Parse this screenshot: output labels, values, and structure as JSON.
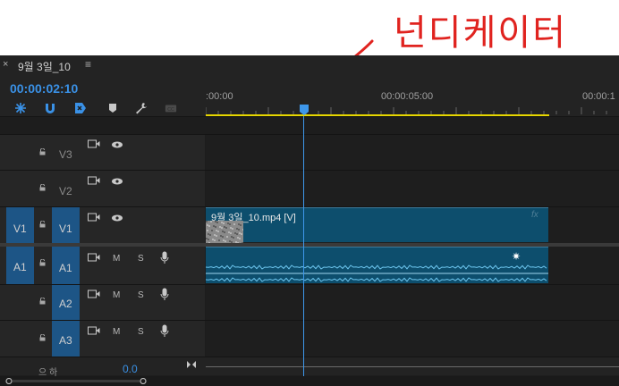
{
  "annotation": {
    "text": "넌디케이터"
  },
  "tab": {
    "close": "×",
    "title": "9월 3일_10",
    "menu": "≡"
  },
  "header": {
    "timecode": "00:00:02:10"
  },
  "tools": [
    {
      "name": "insert-overwrite-icon",
      "color": "#3a91e6"
    },
    {
      "name": "snap-icon",
      "color": "#3a91e6"
    },
    {
      "name": "linked-selection-icon",
      "color": "#3a91e6"
    },
    {
      "name": "add-marker-icon",
      "color": "#c8c8c8"
    },
    {
      "name": "settings-wrench-icon",
      "color": "#c8c8c8"
    },
    {
      "name": "captions-icon",
      "color": "#5a5a5a"
    }
  ],
  "ruler": {
    "labels": [
      ":00:00",
      "00:00:05:00",
      "00:00:1"
    ]
  },
  "tracks": {
    "v3": {
      "label": "V3"
    },
    "v2": {
      "label": "V2"
    },
    "v1": {
      "source": "V1",
      "label": "V1"
    },
    "a1": {
      "source": "A1",
      "label": "A1",
      "mute": "M",
      "solo": "S"
    },
    "a2": {
      "label": "A2",
      "mute": "M",
      "solo": "S"
    },
    "a3": {
      "label": "A3",
      "mute": "M",
      "solo": "S"
    }
  },
  "clips": {
    "video": {
      "name": "9월 3일_10.mp4 [V]",
      "fx": "fx"
    },
    "audio": {
      "fx_icon": "✷"
    }
  },
  "master": {
    "label": "으 하",
    "value": "0.0"
  },
  "colors": {
    "accent": "#3a91e6",
    "clip": "#0d4e6d",
    "work_area": "#e6d600",
    "annotation": "#e0231f"
  }
}
